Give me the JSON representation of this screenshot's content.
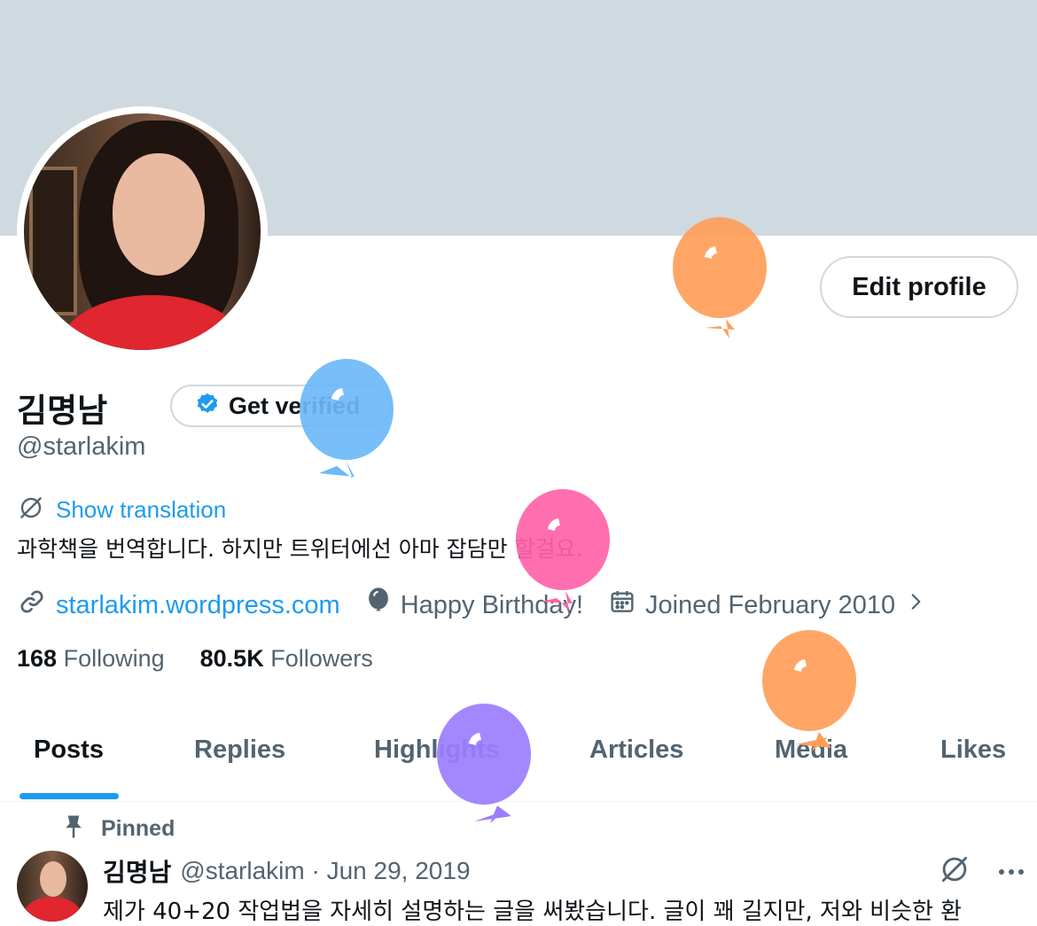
{
  "colors": {
    "banner": "#cfd9e0",
    "accent": "#1d9bf0",
    "text_primary": "#0f1419",
    "text_secondary": "#536471",
    "balloons": [
      "#ff9e59",
      "#6cb9f7",
      "#ff63a8",
      "#9b7dff",
      "#ff9e59"
    ]
  },
  "header": {
    "edit_profile_label": "Edit profile"
  },
  "profile": {
    "name": "김명남",
    "get_verified_label": "Get verified",
    "handle": "@starlakim",
    "show_translation_label": "Show translation",
    "bio": "과학책을 번역합니다. 하지만 트위터에선 아마 잡담만 할걸요.",
    "website": "starlakim.wordpress.com",
    "birthday": "Happy Birthday!",
    "joined": "Joined February 2010",
    "following_count": "168",
    "following_label": "Following",
    "followers_count": "80.5K",
    "followers_label": "Followers"
  },
  "tabs": [
    {
      "label": "Posts",
      "active": true
    },
    {
      "label": "Replies",
      "active": false
    },
    {
      "label": "Highlights",
      "active": false
    },
    {
      "label": "Articles",
      "active": false
    },
    {
      "label": "Media",
      "active": false
    },
    {
      "label": "Likes",
      "active": false
    }
  ],
  "pinned_post": {
    "pinned_label": "Pinned",
    "author_name": "김명남",
    "meta": "@starlakim · Jun 29, 2019",
    "text": "제가 40+20 작업법을 자세히 설명하는 글을 써봤습니다. 글이 꽤 길지만, 저와 비슷한 환"
  },
  "icons": {
    "verified": "verified-badge-icon",
    "translate": "translate-icon",
    "link": "link-icon",
    "balloon": "balloon-icon",
    "calendar": "calendar-icon",
    "chevron": "chevron-right-icon",
    "pin": "pin-icon",
    "more": "more-icon",
    "grok": "grok-icon"
  }
}
